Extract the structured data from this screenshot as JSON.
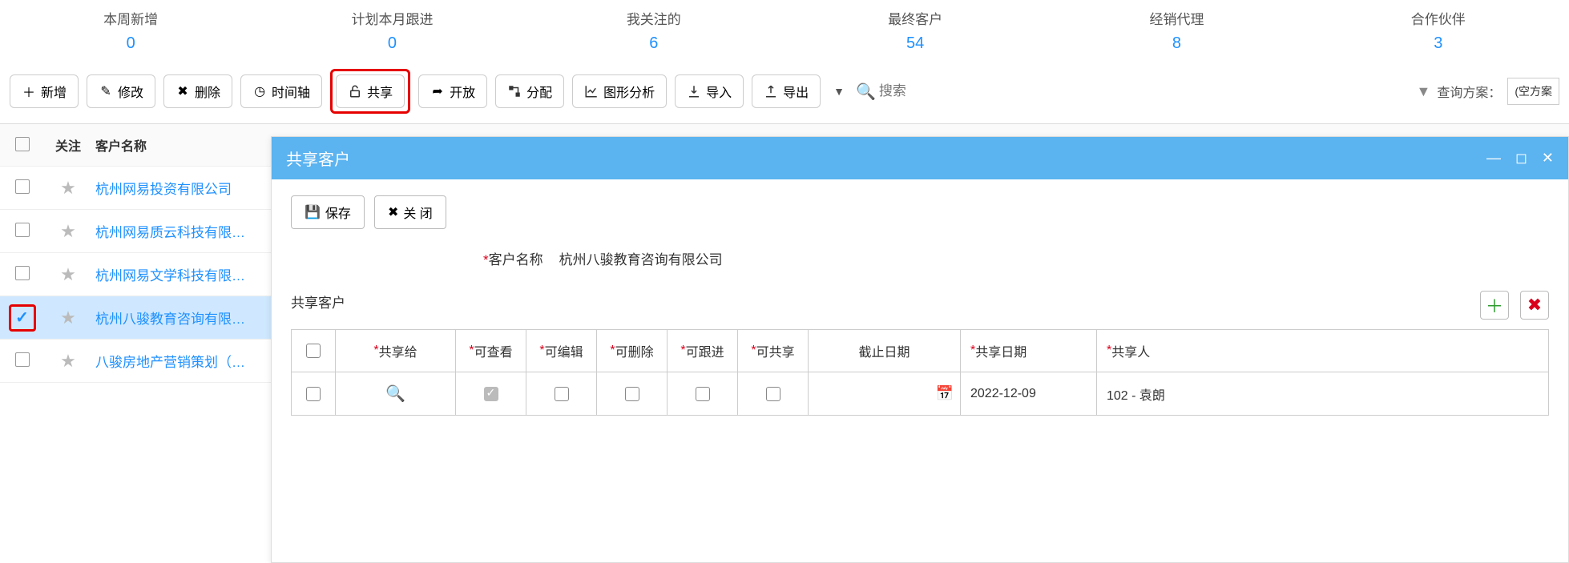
{
  "stats": [
    {
      "label": "本周新增",
      "value": "0"
    },
    {
      "label": "计划本月跟进",
      "value": "0"
    },
    {
      "label": "我关注的",
      "value": "6"
    },
    {
      "label": "最终客户",
      "value": "54"
    },
    {
      "label": "经销代理",
      "value": "8"
    },
    {
      "label": "合作伙伴",
      "value": "3"
    }
  ],
  "toolbar": {
    "add": "新增",
    "edit": "修改",
    "delete": "删除",
    "timeline": "时间轴",
    "share": "共享",
    "open": "开放",
    "assign": "分配",
    "chart": "图形分析",
    "import": "导入",
    "export": "导出",
    "search_placeholder": "搜索",
    "filter_label": "查询方案：",
    "filter_value": "(空方案"
  },
  "table": {
    "headers": {
      "follow": "关注",
      "name": "客户名称"
    },
    "rows": [
      {
        "name": "杭州网易投资有限公司",
        "checked": false
      },
      {
        "name": "杭州网易质云科技有限…",
        "checked": false
      },
      {
        "name": "杭州网易文学科技有限…",
        "checked": false
      },
      {
        "name": "杭州八骏教育咨询有限…",
        "checked": true
      },
      {
        "name": "八骏房地产营销策划（…",
        "checked": false
      }
    ]
  },
  "modal": {
    "title": "共享客户",
    "save": "保存",
    "close": "关 闭",
    "form": {
      "name_label": "客户名称",
      "name_value": "杭州八骏教育咨询有限公司"
    },
    "sub_title": "共享客户",
    "grid": {
      "headers": {
        "share_to": "共享给",
        "view": "可查看",
        "edit": "可编辑",
        "delete": "可删除",
        "follow": "可跟进",
        "share": "可共享",
        "end_date": "截止日期",
        "share_date": "共享日期",
        "sharer": "共享人"
      },
      "row": {
        "share_date": "2022-12-09",
        "sharer": "102 - 袁朗"
      }
    }
  }
}
